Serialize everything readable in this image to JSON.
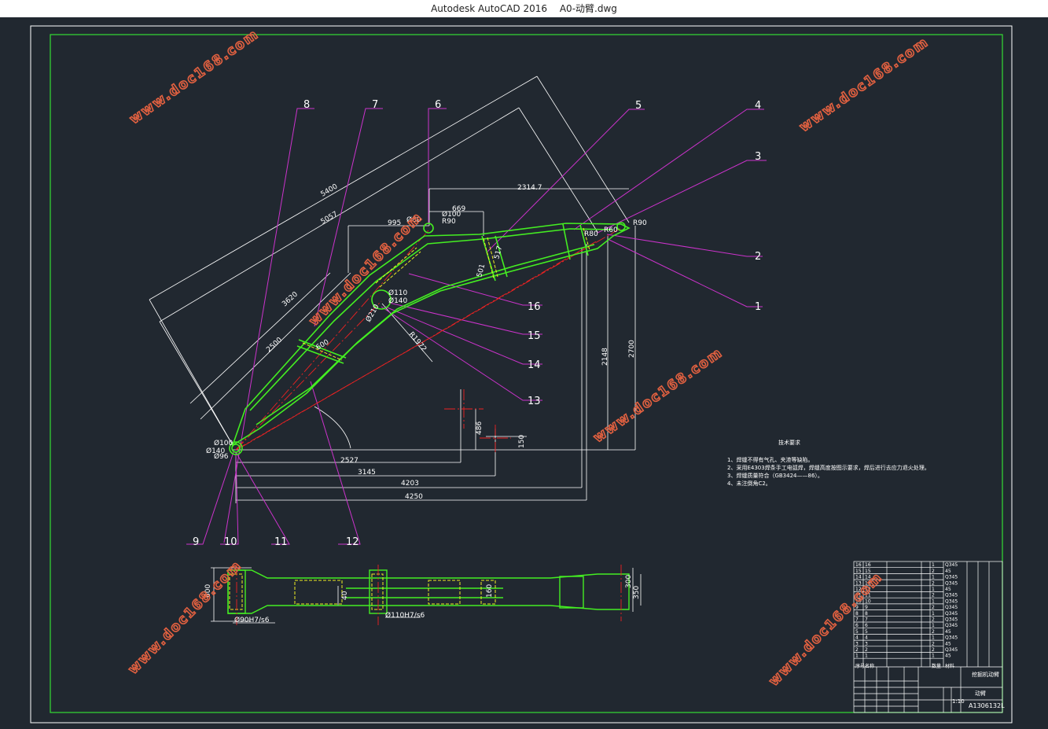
{
  "window": {
    "app_name": "Autodesk AutoCAD 2016",
    "file_name": "A0-动臂.dwg"
  },
  "watermark": "www.doc168.com",
  "colors": {
    "background": "#212830",
    "frame": "#ffffff",
    "border": "#33dd33",
    "part": "#44ee22",
    "leader": "#cc33cc",
    "dim": "#ffffff",
    "center": "#ee2222",
    "hidden": "#eeee22"
  },
  "balloons": {
    "b1": "1",
    "b2": "2",
    "b3": "3",
    "b4": "4",
    "b5": "5",
    "b6": "6",
    "b7": "7",
    "b8": "8",
    "b9": "9",
    "b10": "10",
    "b11": "11",
    "b12": "12",
    "b13": "13",
    "b14": "14",
    "b15": "15",
    "b16": "16"
  },
  "dimensions": {
    "d2314": "2314.7",
    "d669": "669",
    "d995": "995",
    "d5400": "5400",
    "d5057": "5057",
    "d3620": "3620",
    "d2500": "2500",
    "d2527": "2527",
    "d3145": "3145",
    "d4203": "4203",
    "d4250": "4250",
    "d2148": "2148",
    "d2700": "2700",
    "d486": "486",
    "d150": "150",
    "d1972": "R1972",
    "d600": "600",
    "d517": "517",
    "d501": "501",
    "r80": "R80",
    "r60": "R60",
    "r90": "R90",
    "r100": "Ø100",
    "r90b": "R90",
    "d110": "Ø110",
    "d140": "Ø140",
    "d210": "Ø210",
    "d100l": "Ø100",
    "d140l": "Ø140",
    "d96l": "Ø96",
    "d80": "Ø80",
    "p600": "600",
    "p40": "40",
    "p160": "160",
    "p350": "350",
    "p300": "300",
    "fit1": "Ø90H7/s6",
    "fit2": "Ø110H7/s6"
  },
  "notes": {
    "title": "技术要求",
    "n1": "1、焊缝不得有气孔、夹渣等缺陷。",
    "n2": "2、采用E4303焊条手工电弧焊，焊缝高度按图示要求，焊后进行去应力退火处理。",
    "n3": "3、焊缝质量符合（GB3424——86）。",
    "n4": "4、未注倒角C2。"
  },
  "title_block": {
    "rows": [
      {
        "no": "16",
        "name": "16",
        "qty": "1",
        "mat": "Q345"
      },
      {
        "no": "15",
        "name": "15",
        "qty": "2",
        "mat": "45"
      },
      {
        "no": "14",
        "name": "14",
        "qty": "1",
        "mat": "Q345"
      },
      {
        "no": "13",
        "name": "13",
        "qty": "2",
        "mat": "Q345"
      },
      {
        "no": "12",
        "name": "12",
        "qty": "1",
        "mat": "45"
      },
      {
        "no": "11",
        "name": "11",
        "qty": "2",
        "mat": "Q345"
      },
      {
        "no": "10",
        "name": "10",
        "qty": "1",
        "mat": "Q345"
      },
      {
        "no": "9",
        "name": "9",
        "qty": "2",
        "mat": "Q345"
      },
      {
        "no": "8",
        "name": "8",
        "qty": "1",
        "mat": "Q345"
      },
      {
        "no": "7",
        "name": "7",
        "qty": "2",
        "mat": "Q345"
      },
      {
        "no": "6",
        "name": "6",
        "qty": "1",
        "mat": "Q345"
      },
      {
        "no": "5",
        "name": "5",
        "qty": "2",
        "mat": "45"
      },
      {
        "no": "4",
        "name": "4",
        "qty": "1",
        "mat": "Q345"
      },
      {
        "no": "3",
        "name": "3",
        "qty": "2",
        "mat": "45"
      },
      {
        "no": "2",
        "name": "2",
        "qty": "2",
        "mat": "Q345"
      },
      {
        "no": "1",
        "name": "1",
        "qty": "1",
        "mat": "45"
      }
    ],
    "header": {
      "no": "序号",
      "name": "名称",
      "qty": "数量",
      "mat": "材料"
    },
    "drawing_name": "挖掘机动臂",
    "part_name": "动臂",
    "scale": "1:10",
    "drawing_no": "A1306132L"
  }
}
